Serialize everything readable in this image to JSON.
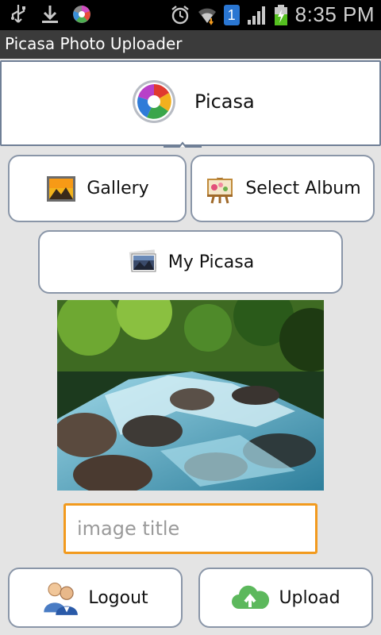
{
  "status_bar": {
    "time": "8:35 PM",
    "left_icons": [
      "usb-icon",
      "download-icon",
      "picasa-notification-icon"
    ],
    "right_icons": [
      "alarm-icon",
      "wifi-icon",
      "sim-1-icon",
      "signal-icon",
      "battery-charging-icon"
    ],
    "sim_label": "1"
  },
  "app_title": "Picasa Photo Uploader",
  "header": {
    "label": "Picasa",
    "icon": "picasa-logo-icon"
  },
  "buttons": {
    "gallery": {
      "label": "Gallery",
      "icon": "gallery-icon"
    },
    "select_album": {
      "label": "Select Album",
      "icon": "easel-icon"
    },
    "my_picasa": {
      "label": "My Picasa",
      "icon": "photo-stack-icon"
    },
    "logout": {
      "label": "Logout",
      "icon": "users-icon"
    },
    "upload": {
      "label": "Upload",
      "icon": "cloud-upload-icon"
    }
  },
  "image_title_input": {
    "placeholder": "image title",
    "value": ""
  },
  "colors": {
    "accent_orange": "#f29a1e",
    "title_bar": "#3b3b3b",
    "button_border": "#8a96a8"
  }
}
